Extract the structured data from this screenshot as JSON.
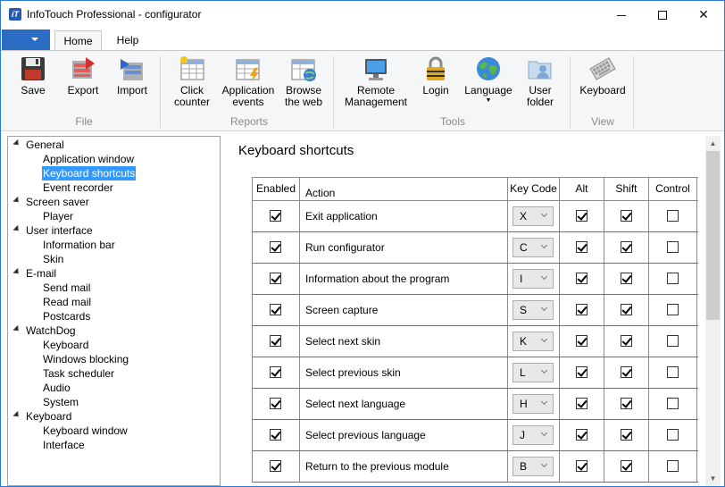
{
  "window": {
    "title": "InfoTouch Professional - configurator",
    "app_icon_glyph": "iT",
    "accent": "#2b79d7"
  },
  "ribbon": {
    "tabs": [
      {
        "label": "Home",
        "active": true
      },
      {
        "label": "Help",
        "active": false
      }
    ],
    "buttons": {
      "save": "Save",
      "export": "Export",
      "import": "Import",
      "click_counter": "Click counter",
      "application_events": "Application events",
      "browse_web": "Browse the web",
      "remote_management": "Remote Management",
      "login": "Login",
      "language": "Language",
      "user_folder": "User folder",
      "keyboard": "Keyboard"
    },
    "groups": {
      "file": "File",
      "reports": "Reports",
      "tools": "Tools",
      "view": "View"
    }
  },
  "tree": {
    "items": [
      {
        "label": "General",
        "level": 0
      },
      {
        "label": "Application window",
        "level": 1
      },
      {
        "label": "Keyboard shortcuts",
        "level": 1,
        "selected": true
      },
      {
        "label": "Event recorder",
        "level": 1
      },
      {
        "label": "Screen saver",
        "level": 0
      },
      {
        "label": "Player",
        "level": 1
      },
      {
        "label": "User interface",
        "level": 0
      },
      {
        "label": "Information bar",
        "level": 1
      },
      {
        "label": "Skin",
        "level": 1
      },
      {
        "label": "E-mail",
        "level": 0
      },
      {
        "label": "Send mail",
        "level": 1
      },
      {
        "label": "Read mail",
        "level": 1
      },
      {
        "label": "Postcards",
        "level": 1
      },
      {
        "label": "WatchDog",
        "level": 0
      },
      {
        "label": "Keyboard",
        "level": 1
      },
      {
        "label": "Windows blocking",
        "level": 1
      },
      {
        "label": "Task scheduler",
        "level": 1
      },
      {
        "label": "Audio",
        "level": 1
      },
      {
        "label": "System",
        "level": 1
      },
      {
        "label": "Keyboard",
        "level": 0
      },
      {
        "label": "Keyboard window",
        "level": 1
      },
      {
        "label": "Interface",
        "level": 1
      }
    ]
  },
  "content": {
    "title": "Keyboard shortcuts",
    "columns": {
      "enabled": "Enabled",
      "action": "Action",
      "key_code": "Key Code",
      "alt": "Alt",
      "shift": "Shift",
      "control": "Control"
    },
    "rows": [
      {
        "enabled": true,
        "action": "Exit application",
        "key": "X",
        "alt": true,
        "shift": true,
        "control": false
      },
      {
        "enabled": true,
        "action": "Run configurator",
        "key": "C",
        "alt": true,
        "shift": true,
        "control": false
      },
      {
        "enabled": true,
        "action": "Information about the program",
        "key": "I",
        "alt": true,
        "shift": true,
        "control": false
      },
      {
        "enabled": true,
        "action": "Screen capture",
        "key": "S",
        "alt": true,
        "shift": true,
        "control": false
      },
      {
        "enabled": true,
        "action": "Select next skin",
        "key": "K",
        "alt": true,
        "shift": true,
        "control": false
      },
      {
        "enabled": true,
        "action": "Select previous skin",
        "key": "L",
        "alt": true,
        "shift": true,
        "control": false
      },
      {
        "enabled": true,
        "action": "Select next language",
        "key": "H",
        "alt": true,
        "shift": true,
        "control": false
      },
      {
        "enabled": true,
        "action": "Select previous language",
        "key": "J",
        "alt": true,
        "shift": true,
        "control": false
      },
      {
        "enabled": true,
        "action": "Return to the previous module",
        "key": "B",
        "alt": true,
        "shift": true,
        "control": false
      }
    ]
  }
}
